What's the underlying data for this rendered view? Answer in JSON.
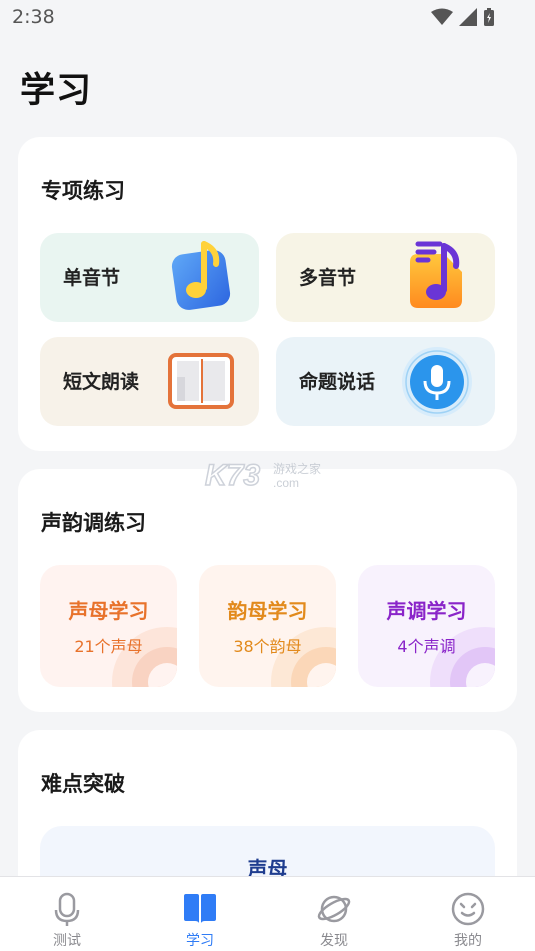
{
  "status_bar": {
    "time": "2:38"
  },
  "page": {
    "title": "学习"
  },
  "special_practice": {
    "title": "专项练习",
    "items": [
      {
        "label": "单音节",
        "icon": "music-note-icon"
      },
      {
        "label": "多音节",
        "icon": "music-playlist-icon"
      },
      {
        "label": "短文朗读",
        "icon": "open-book-icon"
      },
      {
        "label": "命题说话",
        "icon": "microphone-icon"
      }
    ]
  },
  "tone_practice": {
    "title": "声韵调练习",
    "items": [
      {
        "title": "声母学习",
        "subtitle": "21个声母",
        "color": "#e8722b"
      },
      {
        "title": "韵母学习",
        "subtitle": "38个韵母",
        "color": "#e28a1c"
      },
      {
        "title": "声调学习",
        "subtitle": "4个声调",
        "color": "#8a24c9"
      }
    ]
  },
  "difficulty": {
    "title": "难点突破",
    "items": [
      {
        "label": "声母"
      }
    ]
  },
  "watermark": {
    "text": "K73",
    "sub": "游戏之家",
    "domain": ".com"
  },
  "tab_bar": {
    "active": "学习",
    "items": [
      {
        "label": "测试",
        "icon": "microphone-icon"
      },
      {
        "label": "学习",
        "icon": "book-icon"
      },
      {
        "label": "发现",
        "icon": "planet-icon"
      },
      {
        "label": "我的",
        "icon": "smile-face-icon"
      }
    ],
    "active_color": "#2f7cf6"
  }
}
